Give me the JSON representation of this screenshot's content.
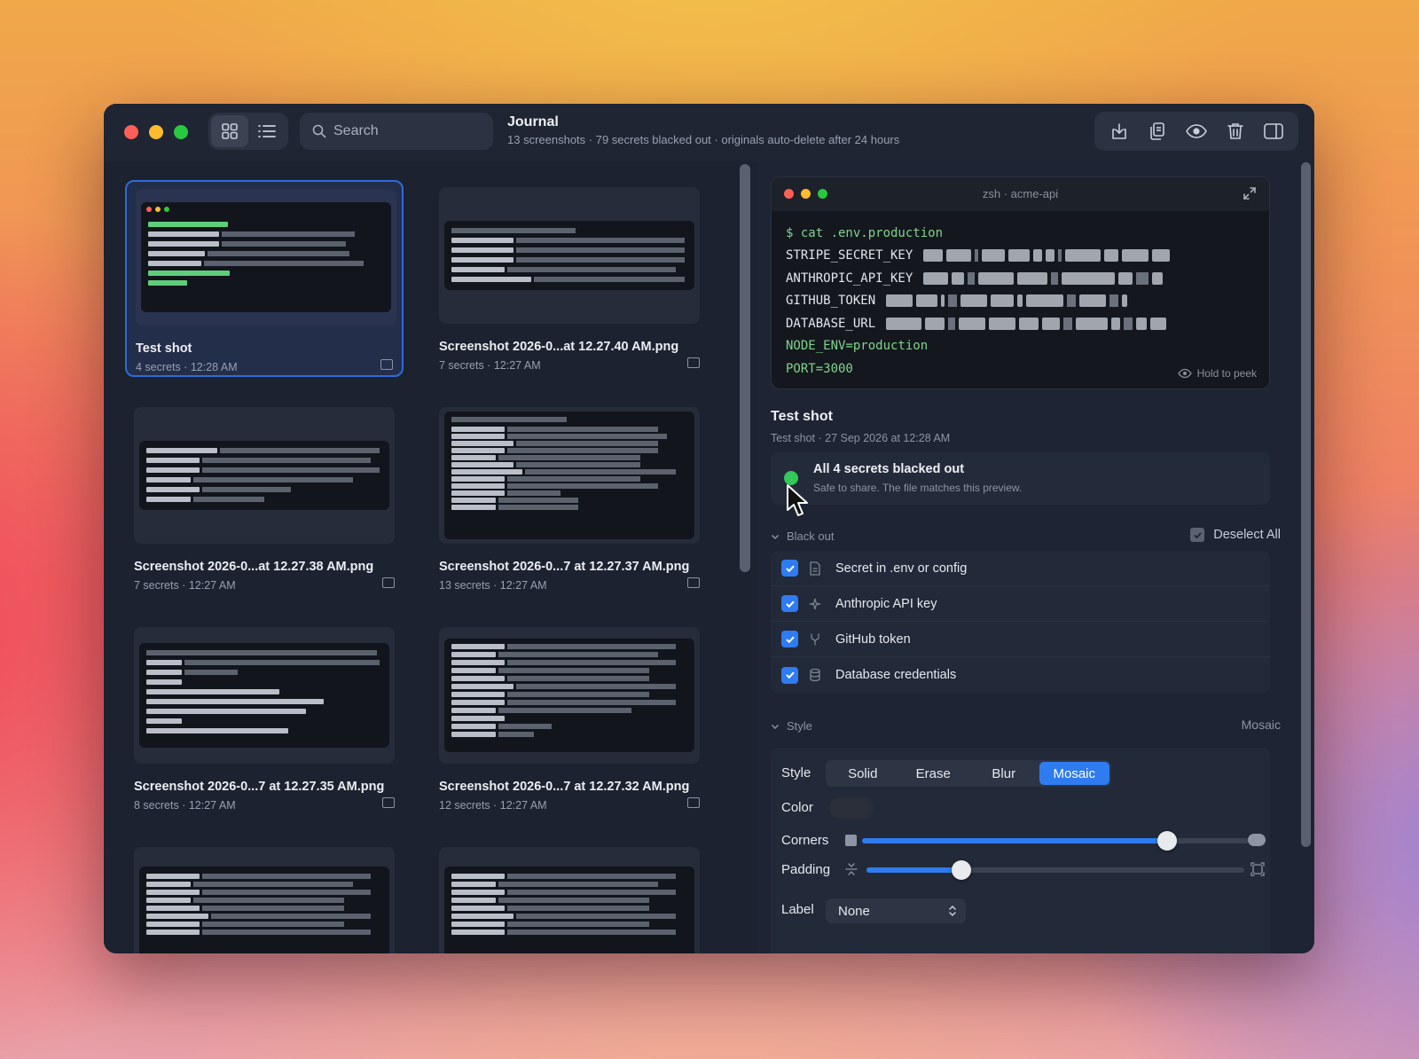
{
  "window": {
    "title": "Journal",
    "subtitle": "13 screenshots · 79 secrets blacked out · originals auto-delete after 24 hours"
  },
  "search": {
    "placeholder": "Search",
    "value": ""
  },
  "toolbar": {
    "icons": [
      "download-icon",
      "copy-icon",
      "eye-icon",
      "trash-icon",
      "sidebar-icon"
    ]
  },
  "grid": {
    "cards": [
      {
        "name": "Test shot",
        "meta": "4 secrets · 12:28 AM",
        "selected": true
      },
      {
        "name": "Screenshot 2026-0...at 12.27.40 AM.png",
        "meta": "7 secrets · 12:27 AM"
      },
      {
        "name": "Screenshot 2026-0...at 12.27.38 AM.png",
        "meta": "7 secrets · 12:27 AM"
      },
      {
        "name": "Screenshot 2026-0...7 at 12.27.37 AM.png",
        "meta": "13 secrets · 12:27 AM"
      },
      {
        "name": "Screenshot 2026-0...7 at 12.27.35 AM.png",
        "meta": "8 secrets · 12:27 AM"
      },
      {
        "name": "Screenshot 2026-0...7 at 12.27.32 AM.png",
        "meta": "12 secrets · 12:27 AM"
      },
      {
        "name": "",
        "meta": ""
      },
      {
        "name": "",
        "meta": ""
      }
    ]
  },
  "preview": {
    "terminal_title": "zsh · acme-api",
    "command": "$ cat .env.production",
    "keys": [
      "STRIPE_SECRET_KEY",
      "ANTHROPIC_API_KEY",
      "GITHUB_TOKEN",
      "DATABASE_URL"
    ],
    "plain_lines": [
      "NODE_ENV=production",
      "PORT=3000"
    ],
    "peek_label": "Hold to peek"
  },
  "detail": {
    "title": "Test shot",
    "subtitle": "Test shot · 27 Sep 2026 at 12:28 AM",
    "status_title": "All 4 secrets blacked out",
    "status_desc": "Safe to share. The file matches this preview."
  },
  "blackout": {
    "header": "Black out",
    "deselect_label": "Deselect All",
    "items": [
      {
        "label": "Secret in .env or config",
        "icon": "file-icon",
        "checked": true
      },
      {
        "label": "Anthropic API key",
        "icon": "sparkle-icon",
        "checked": true
      },
      {
        "label": "GitHub token",
        "icon": "branch-icon",
        "checked": true
      },
      {
        "label": "Database credentials",
        "icon": "database-icon",
        "checked": true
      }
    ]
  },
  "style": {
    "header": "Style",
    "current": "Mosaic",
    "style_label": "Style",
    "options": [
      "Solid",
      "Erase",
      "Blur",
      "Mosaic"
    ],
    "selected": "Mosaic",
    "color_label": "Color",
    "corners_label": "Corners",
    "corners_value": 0.79,
    "padding_label": "Padding",
    "padding_value": 0.25,
    "label_label": "Label",
    "label_value": "None"
  },
  "colors": {
    "accent": "#2f7bf0",
    "success": "#34c759",
    "terminal_green": "#7fd58c"
  }
}
